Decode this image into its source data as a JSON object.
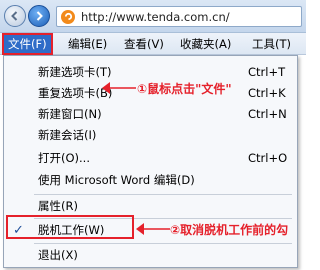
{
  "browser": {
    "url": "http://www.tenda.com.cn/"
  },
  "menubar": {
    "items": [
      {
        "label": "文件(F)"
      },
      {
        "label": "编辑(E)"
      },
      {
        "label": "查看(V)"
      },
      {
        "label": "收藏夹(A)"
      },
      {
        "label": "工具(T)"
      }
    ]
  },
  "file_menu": {
    "items": [
      {
        "label": "新建选项卡(T)",
        "shortcut": "Ctrl+T"
      },
      {
        "label": "重复选项卡(B)",
        "shortcut": "Ctrl+K"
      },
      {
        "label": "新建窗口(N)",
        "shortcut": "Ctrl+N"
      },
      {
        "label": "新建会话(I)",
        "shortcut": ""
      },
      {
        "label": "打开(O)...",
        "shortcut": "Ctrl+O"
      },
      {
        "label": "使用 Microsoft Word 编辑(D)",
        "shortcut": ""
      },
      {
        "label": "属性(R)",
        "shortcut": ""
      },
      {
        "label": "脱机工作(W)",
        "shortcut": "",
        "checked": true
      },
      {
        "label": "退出(X)",
        "shortcut": ""
      }
    ]
  },
  "annotations": {
    "step1": "①鼠标点击\"文件\"",
    "step2": "②取消脱机工作前的勾"
  },
  "colors": {
    "accent_red": "#e5212b",
    "menu_highlight": "#2e6cc8"
  }
}
